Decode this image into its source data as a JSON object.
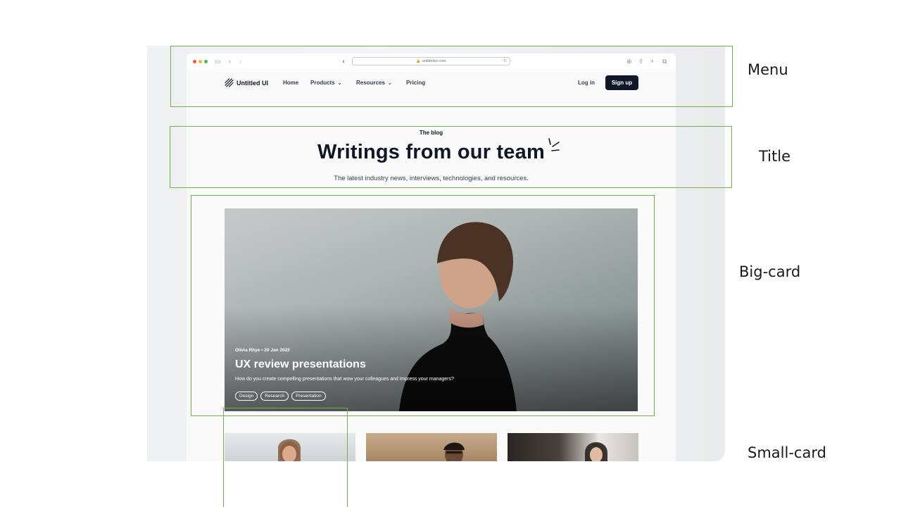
{
  "browser": {
    "url": "untitledui.com"
  },
  "nav": {
    "logo_text": "Untitled UI",
    "links": [
      {
        "label": "Home"
      },
      {
        "label": "Products"
      },
      {
        "label": "Resources"
      },
      {
        "label": "Pricing"
      }
    ],
    "login_label": "Log in",
    "signup_label": "Sign up"
  },
  "header": {
    "eyebrow": "The blog",
    "title": "Writings from our team",
    "subtitle": "The latest industry news, interviews, technologies, and resources."
  },
  "featured": {
    "meta": "Olivia Rhye • 20 Jan 2022",
    "title": "UX review presentations",
    "description": "How do you create compelling presentations that wow your colleagues and impress your managers?",
    "tags": [
      "Design",
      "Research",
      "Presentation"
    ]
  },
  "annotations": {
    "menu": "Menu",
    "title": "Title",
    "big_card": "Big-card",
    "small_card": "Small-card"
  },
  "colors": {
    "annotation_border": "#6fb34f",
    "signup_bg": "#0f1729"
  }
}
